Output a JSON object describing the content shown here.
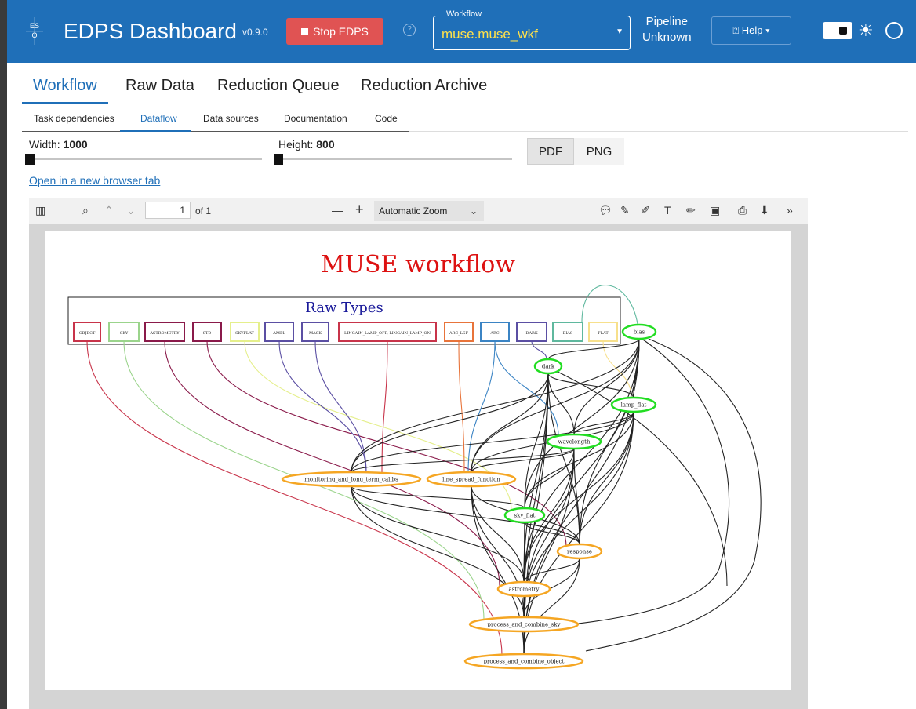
{
  "header": {
    "title": "EDPS Dashboard",
    "version": "v0.9.0",
    "stop_label": "Stop EDPS",
    "help_q": "?",
    "workflow_legend": "Workflow",
    "workflow_value": "muse.muse_wkf",
    "pipeline_label": "Pipeline",
    "pipeline_value": "Unknown",
    "help_label": "⍰ Help ▾",
    "theme_options": [
      "dark",
      "light",
      "auto"
    ],
    "logo_text": "ES O"
  },
  "tabs": [
    "Workflow",
    "Raw Data",
    "Reduction Queue",
    "Reduction Archive"
  ],
  "active_tab": "Workflow",
  "subtabs": [
    "Task dependencies",
    "Dataflow",
    "Data sources",
    "Documentation",
    "Code"
  ],
  "active_subtab": "Dataflow",
  "size_controls": {
    "width_label": "Width:",
    "width_value": "1000",
    "height_label": "Height:",
    "height_value": "800"
  },
  "format_buttons": [
    "PDF",
    "PNG"
  ],
  "selected_format": "PDF",
  "open_link": "Open in a new browser tab",
  "viewer": {
    "page_number": "1",
    "page_count": "of 1",
    "zoom": "Automatic Zoom"
  },
  "graph": {
    "title": "MUSE workflow",
    "raw_types_label": "Raw Types",
    "raw_types": [
      {
        "label": "OBJECT",
        "color": "#c8344a"
      },
      {
        "label": "SKY",
        "color": "#9bd48c"
      },
      {
        "label": "ASTROMETRY",
        "color": "#8a1a4a"
      },
      {
        "label": "STD",
        "color": "#8a1a4a"
      },
      {
        "label": "SKYFLAT",
        "color": "#e5ef8c"
      },
      {
        "label": "AMPL",
        "color": "#5b4fa3"
      },
      {
        "label": "MASK",
        "color": "#5b4fa3"
      },
      {
        "label": "LINGAIN_LAMP_OFF, LINGAIN_LAMP_ON",
        "color": "#c8344a"
      },
      {
        "label": "ARC_LSF",
        "color": "#e8743b"
      },
      {
        "label": "ARC",
        "color": "#3b84c4"
      },
      {
        "label": "DARK",
        "color": "#5b4fa3"
      },
      {
        "label": "BIAS",
        "color": "#5fb89e"
      },
      {
        "label": "FLAT",
        "color": "#f7e08c"
      }
    ],
    "tasks": [
      {
        "label": "bias",
        "color": "#22dd22"
      },
      {
        "label": "dark",
        "color": "#22dd22"
      },
      {
        "label": "lamp_flat",
        "color": "#22dd22"
      },
      {
        "label": "wavelength",
        "color": "#22dd22"
      },
      {
        "label": "monitoring_and_long_term_calibs",
        "color": "#f5a623"
      },
      {
        "label": "line_spread_function",
        "color": "#f5a623"
      },
      {
        "label": "sky_flat",
        "color": "#22dd22"
      },
      {
        "label": "response",
        "color": "#f5a623"
      },
      {
        "label": "astrometry",
        "color": "#f5a623"
      },
      {
        "label": "process_and_combine_sky",
        "color": "#f5a623"
      },
      {
        "label": "process_and_combine_object",
        "color": "#f5a623"
      }
    ]
  }
}
